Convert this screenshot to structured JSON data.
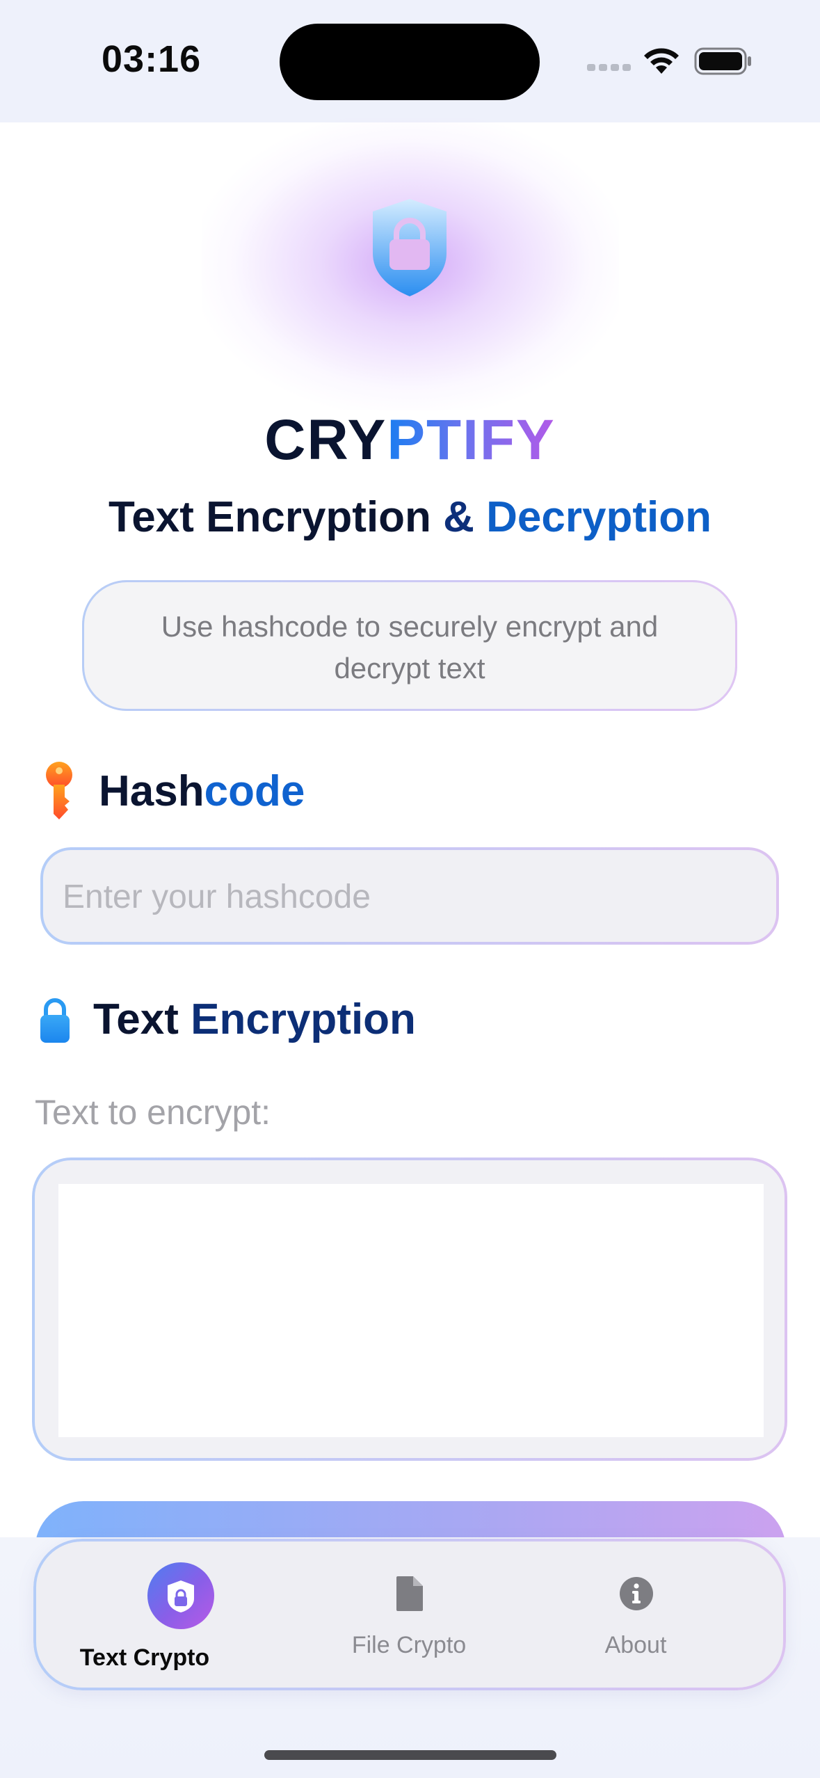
{
  "status_bar": {
    "time": "03:16"
  },
  "brand": {
    "part1": "CRY",
    "part2": "PTIFY"
  },
  "subtitle": {
    "part1": "Text Encryption",
    "amp": " & ",
    "part2": "Decryption"
  },
  "description": "Use hashcode to securely encrypt and decrypt text",
  "hashcode_section": {
    "title_part1": "Hash",
    "title_part2": "code",
    "input_placeholder": "Enter your hashcode",
    "input_value": ""
  },
  "encryption_section": {
    "title_part1": "Text ",
    "title_part2": "Encryption",
    "field_label": "Text to encrypt:",
    "textarea_value": ""
  },
  "tabbar": {
    "tabs": [
      {
        "label": "Text Crypto",
        "icon": "shield-icon",
        "active": true
      },
      {
        "label": "File Crypto",
        "icon": "document-icon",
        "active": false
      },
      {
        "label": "About",
        "icon": "info-icon",
        "active": false
      }
    ]
  },
  "colors": {
    "accent_blue": "#0f62cf",
    "accent_purple": "#b25ae8",
    "navy": "#0a1430"
  }
}
